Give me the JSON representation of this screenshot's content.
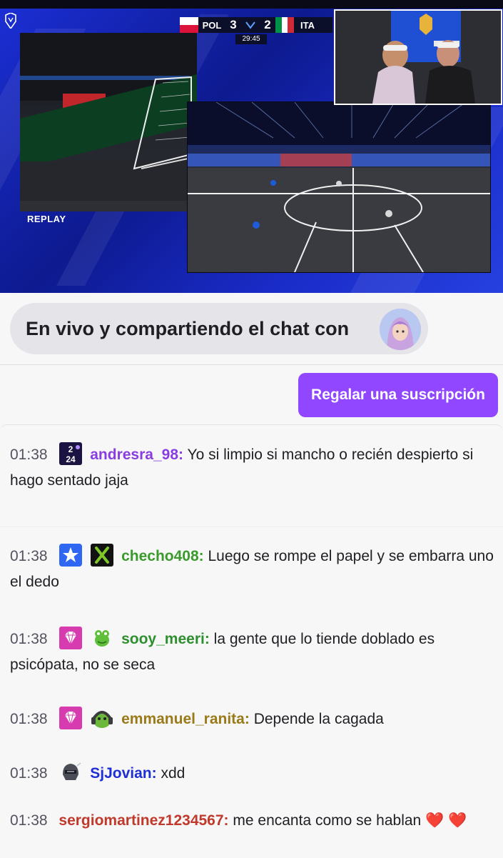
{
  "stream": {
    "scoreboard": {
      "home_team": "POL",
      "home_score": "3",
      "away_score": "2",
      "away_team": "ITA",
      "clock": "29:45"
    },
    "replay_label": "REPLAY"
  },
  "shared_chat": {
    "text": "En vivo y compartiendo el chat con"
  },
  "gift_button": {
    "label": "Regalar una suscripción"
  },
  "colors": {
    "accent": "#9147ff",
    "chat_bg": "#f7f7f8"
  },
  "chat": {
    "messages": [
      {
        "time": "01:38",
        "badges": [
          "2024-badge-icon"
        ],
        "user": "andresra_98",
        "user_color": "#8a3ce0",
        "text": "Yo si limpio si mancho o recién despierto si hago sentado jaja"
      },
      {
        "time": "01:38",
        "badges": [
          "star-badge-icon",
          "xbox-badge-icon"
        ],
        "user": "checho408",
        "user_color": "#3a9a2c",
        "text": "Luego se rompe el papel y se embarra uno el dedo"
      },
      {
        "time": "01:38",
        "badges": [
          "sub-gem-badge-icon",
          "frog-badge-icon"
        ],
        "user": "sooy_meeri",
        "user_color": "#2e8f2e",
        "text": "la gente que lo tiende doblado es psicópata, no se seca"
      },
      {
        "time": "01:38",
        "badges": [
          "sub-gem-badge-icon",
          "frog-headset-badge-icon"
        ],
        "user": "emmanuel_ranita",
        "user_color": "#9a7a18",
        "text": "Depende la cagada"
      },
      {
        "time": "01:38",
        "badges": [
          "helmet-badge-icon"
        ],
        "user": "SjJovian",
        "user_color": "#1f2fd6",
        "text": "xdd"
      },
      {
        "time": "01:38",
        "badges": [],
        "user": "sergiomartinez1234567",
        "user_color": "#c0392b",
        "text": "me encanta como se hablan ❤️ ❤️"
      }
    ]
  }
}
